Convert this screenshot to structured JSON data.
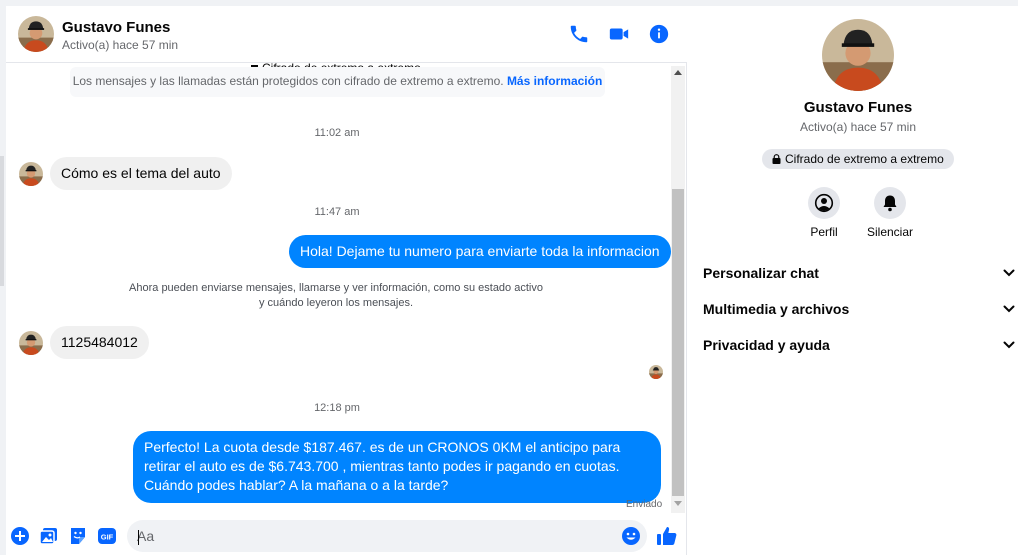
{
  "contact": {
    "name": "Gustavo Funes",
    "status": "Activo(a) hace 57 min"
  },
  "header_icons": [
    "phone-icon",
    "video-camera-icon",
    "info-icon"
  ],
  "colors": {
    "accent": "#0866ff",
    "outgoing_bubble": "#0084ff",
    "incoming_bubble": "#f0f0f0",
    "secondary_text": "#65676b"
  },
  "encryption_banner": {
    "title": "Cifrado de extremo a extremo",
    "text": "Los mensajes y las llamadas están protegidos con cifrado de extremo a extremo.",
    "link": "Más información"
  },
  "messages": {
    "ts1": "11:02 am",
    "m1": "Cómo es el tema del auto",
    "ts2": "11:47 am",
    "m2": "Hola! Dejame tu numero  para enviarte toda la informacion",
    "notice_line1": "Ahora pueden enviarse mensajes, llamarse y ver información, como su estado activo",
    "notice_line2": "y cuándo leyeron los mensajes.",
    "m3": "1125484012",
    "ts3": "12:18 pm",
    "m4": "Perfecto! La cuota desde $187.467. es de un CRONOS 0KM el anticipo para retirar el auto es de $6.743.700 , mientras tanto podes ir pagando en cuotas. Cuándo podes hablar? A la mañana o a la tarde?",
    "sent_status": "Enviado"
  },
  "composer": {
    "placeholder": "Aa",
    "icons": [
      "plus-icon",
      "image-icon",
      "sticker-icon",
      "gif-icon",
      "emoji-icon",
      "thumbs-up-icon"
    ],
    "gif_label": "GIF"
  },
  "info_panel": {
    "name": "Gustavo Funes",
    "status": "Activo(a) hace 57 min",
    "encryption_badge": "Cifrado de extremo a extremo",
    "actions": [
      {
        "label": "Perfil",
        "icon": "profile-icon"
      },
      {
        "label": "Silenciar",
        "icon": "bell-icon"
      }
    ],
    "sections": [
      {
        "label": "Personalizar chat"
      },
      {
        "label": "Multimedia y archivos"
      },
      {
        "label": "Privacidad y ayuda"
      }
    ]
  }
}
